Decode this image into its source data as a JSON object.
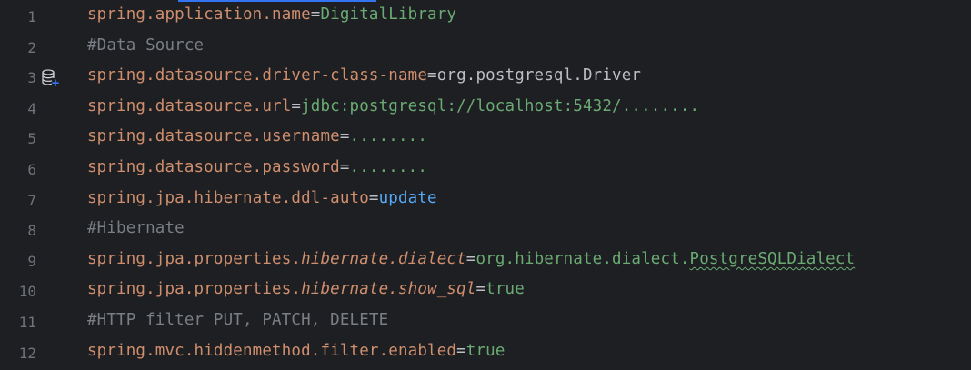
{
  "editor": {
    "lines": [
      {
        "num": "1",
        "key": "spring.application.name",
        "eq": "=",
        "value": "DigitalLibrary"
      },
      {
        "num": "2",
        "comment": "#Data Source"
      },
      {
        "num": "3",
        "key": "spring.datasource.driver-class-name",
        "eq": "=",
        "value": "org.postgresql.Driver",
        "icon": "database-add-icon"
      },
      {
        "num": "4",
        "key": "spring.datasource.url",
        "eq": "=",
        "value": "jdbc:postgresql://localhost:5432/........"
      },
      {
        "num": "5",
        "key": "spring.datasource.username",
        "eq": "=",
        "value": "........"
      },
      {
        "num": "6",
        "key": "spring.datasource.password",
        "eq": "=",
        "value": "........"
      },
      {
        "num": "7",
        "key": "spring.jpa.hibernate.ddl-auto",
        "eq": "=",
        "value": "update"
      },
      {
        "num": "8",
        "comment": "#Hibernate"
      },
      {
        "num": "9",
        "key_prefix": "spring.jpa.properties.",
        "key_italic": "hibernate.dialect",
        "eq": "=",
        "value_prefix": "org.hibernate.dialect.",
        "value_squiggle": "PostgreSQLDialect"
      },
      {
        "num": "10",
        "key_prefix": "spring.jpa.properties.",
        "key_italic": "hibernate.show_sql",
        "eq": "=",
        "value": "true"
      },
      {
        "num": "11",
        "comment": "#HTTP filter PUT, PATCH, DELETE"
      },
      {
        "num": "12",
        "key": "spring.mvc.hiddenmethod.filter.enabled",
        "eq": "=",
        "value": "true"
      }
    ]
  },
  "colors": {
    "background": "#1e1f22",
    "line_number": "#6f737a",
    "key": "#cf8e6d",
    "value_string": "#6aab73",
    "value_keyword": "#56a8f5",
    "comment": "#7a7e85"
  }
}
